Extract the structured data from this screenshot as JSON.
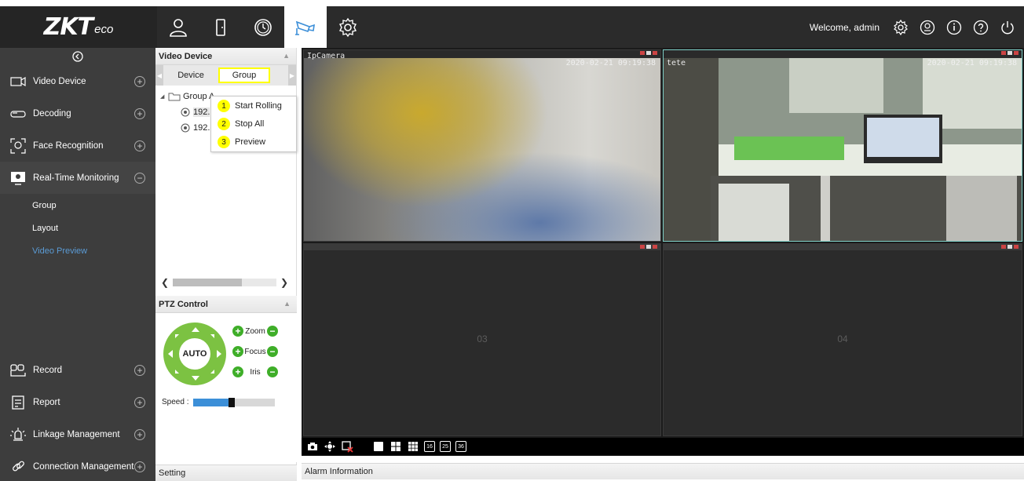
{
  "app": {
    "brand": "ZKT",
    "brand_suffix": "eco",
    "welcome": "Welcome, admin"
  },
  "topnav": {
    "items": [
      {
        "icon": "person-icon"
      },
      {
        "icon": "door-icon"
      },
      {
        "icon": "clock-icon"
      },
      {
        "icon": "camera-icon",
        "active": true
      },
      {
        "icon": "gear-icon"
      }
    ],
    "right_icons": [
      "settings-icon",
      "user-circle-icon",
      "info-icon",
      "help-icon",
      "power-icon"
    ]
  },
  "sidebar": {
    "items": [
      {
        "label": "Video Device",
        "icon": "video-device-icon",
        "state": "+"
      },
      {
        "label": "Decoding",
        "icon": "decoding-icon",
        "state": "+"
      },
      {
        "label": "Face Recognition",
        "icon": "face-recognition-icon",
        "state": "+"
      },
      {
        "label": "Real-Time Monitoring",
        "icon": "monitor-icon",
        "state": "−"
      }
    ],
    "sub_items": [
      "Group",
      "Layout",
      "Video Preview"
    ],
    "active_sub": "Video Preview",
    "bottom_items": [
      {
        "label": "Record",
        "icon": "record-icon",
        "state": "+"
      },
      {
        "label": "Report",
        "icon": "report-icon",
        "state": "+"
      },
      {
        "label": "Linkage Management",
        "icon": "linkage-icon",
        "state": "+"
      },
      {
        "label": "Connection Management",
        "icon": "connection-icon",
        "state": "+"
      }
    ]
  },
  "device_panel": {
    "title": "Video Device",
    "tabs": [
      "Device",
      "Group"
    ],
    "selected_tab": "Group",
    "tree": {
      "group": "Group A",
      "children": [
        "192.",
        "192."
      ]
    }
  },
  "context_menu": {
    "items": [
      {
        "num": "1",
        "label": "Start Rolling"
      },
      {
        "num": "2",
        "label": "Stop All"
      },
      {
        "num": "3",
        "label": "Preview"
      }
    ]
  },
  "ptz": {
    "title": "PTZ Control",
    "auto": "AUTO",
    "zoom": "Zoom",
    "focus": "Focus",
    "iris": "Iris",
    "speed_label": "Speed :",
    "speed_level": 0.47
  },
  "setting_label": "Setting",
  "alarm_label": "Alarm Information",
  "video": {
    "cells": [
      {
        "name": "IpCamera",
        "time": "2020-02-21 09:19:38"
      },
      {
        "name": "tete",
        "time": "2020-02-21 09:19:38"
      },
      {
        "name": "",
        "number": "03"
      },
      {
        "name": "",
        "number": "04"
      }
    ],
    "toolbar_labels": [
      "16",
      "25",
      "36"
    ]
  },
  "colors": {
    "accent": "#5b9bd5",
    "topbar": "#2b2b2b",
    "sidebar": "#3d3d3d",
    "highlight": "#ffff00",
    "ptz_green": "#7cc242"
  }
}
